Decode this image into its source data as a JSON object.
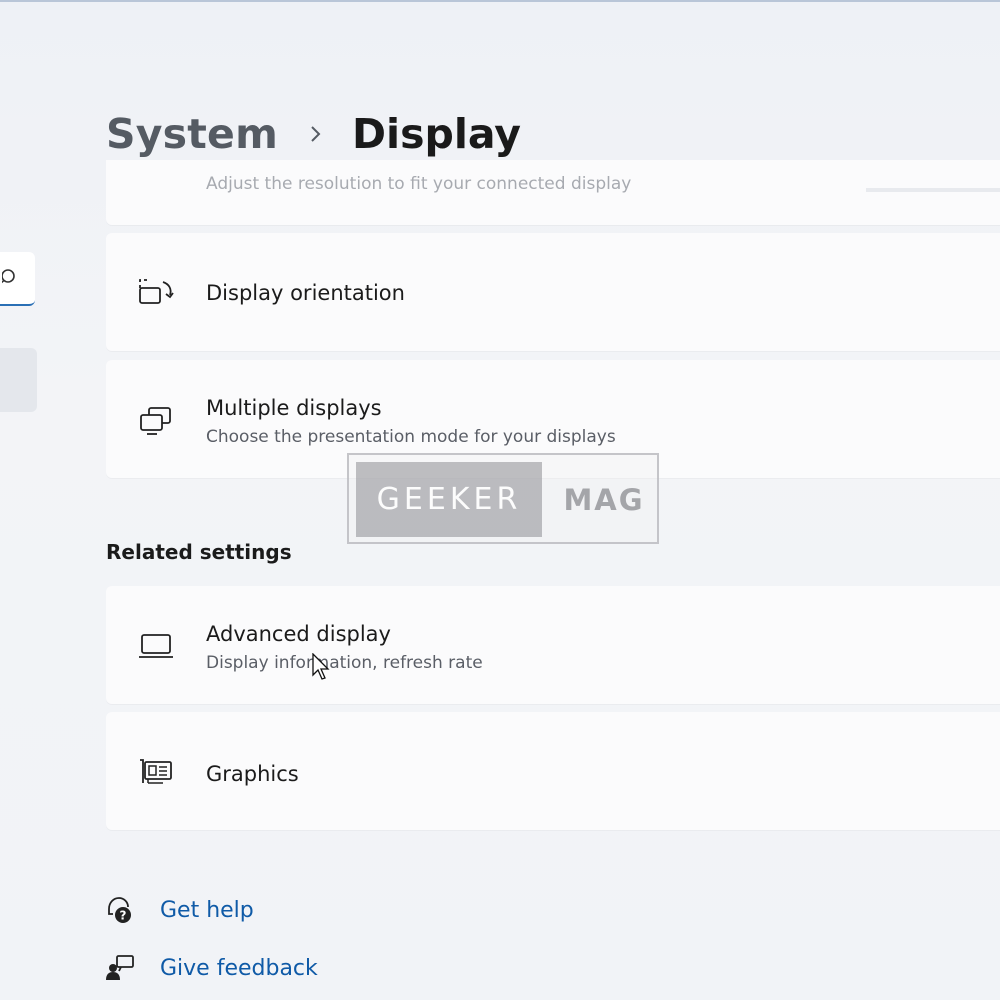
{
  "breadcrumb": {
    "parent": "System",
    "current": "Display"
  },
  "cards": {
    "resolution": {
      "subtitle": "Adjust the resolution to fit your connected display"
    },
    "orientation": {
      "title": "Display orientation",
      "icon": "display-orientation-icon"
    },
    "multiple_displays": {
      "title": "Multiple displays",
      "subtitle": "Choose the presentation mode for your displays",
      "icon": "multiple-displays-icon"
    }
  },
  "related_settings": {
    "heading": "Related settings",
    "advanced_display": {
      "title": "Advanced display",
      "subtitle": "Display information, refresh rate",
      "icon": "laptop-icon"
    },
    "graphics": {
      "title": "Graphics",
      "icon": "graphics-card-icon"
    }
  },
  "footer": {
    "get_help": "Get help",
    "give_feedback": "Give feedback"
  },
  "watermark": {
    "left": "GEEKER",
    "right": "MAG"
  },
  "colors": {
    "accent": "#0f5aa7",
    "card_bg": "#fbfbfc",
    "page_bg": "#f1f3f7"
  }
}
